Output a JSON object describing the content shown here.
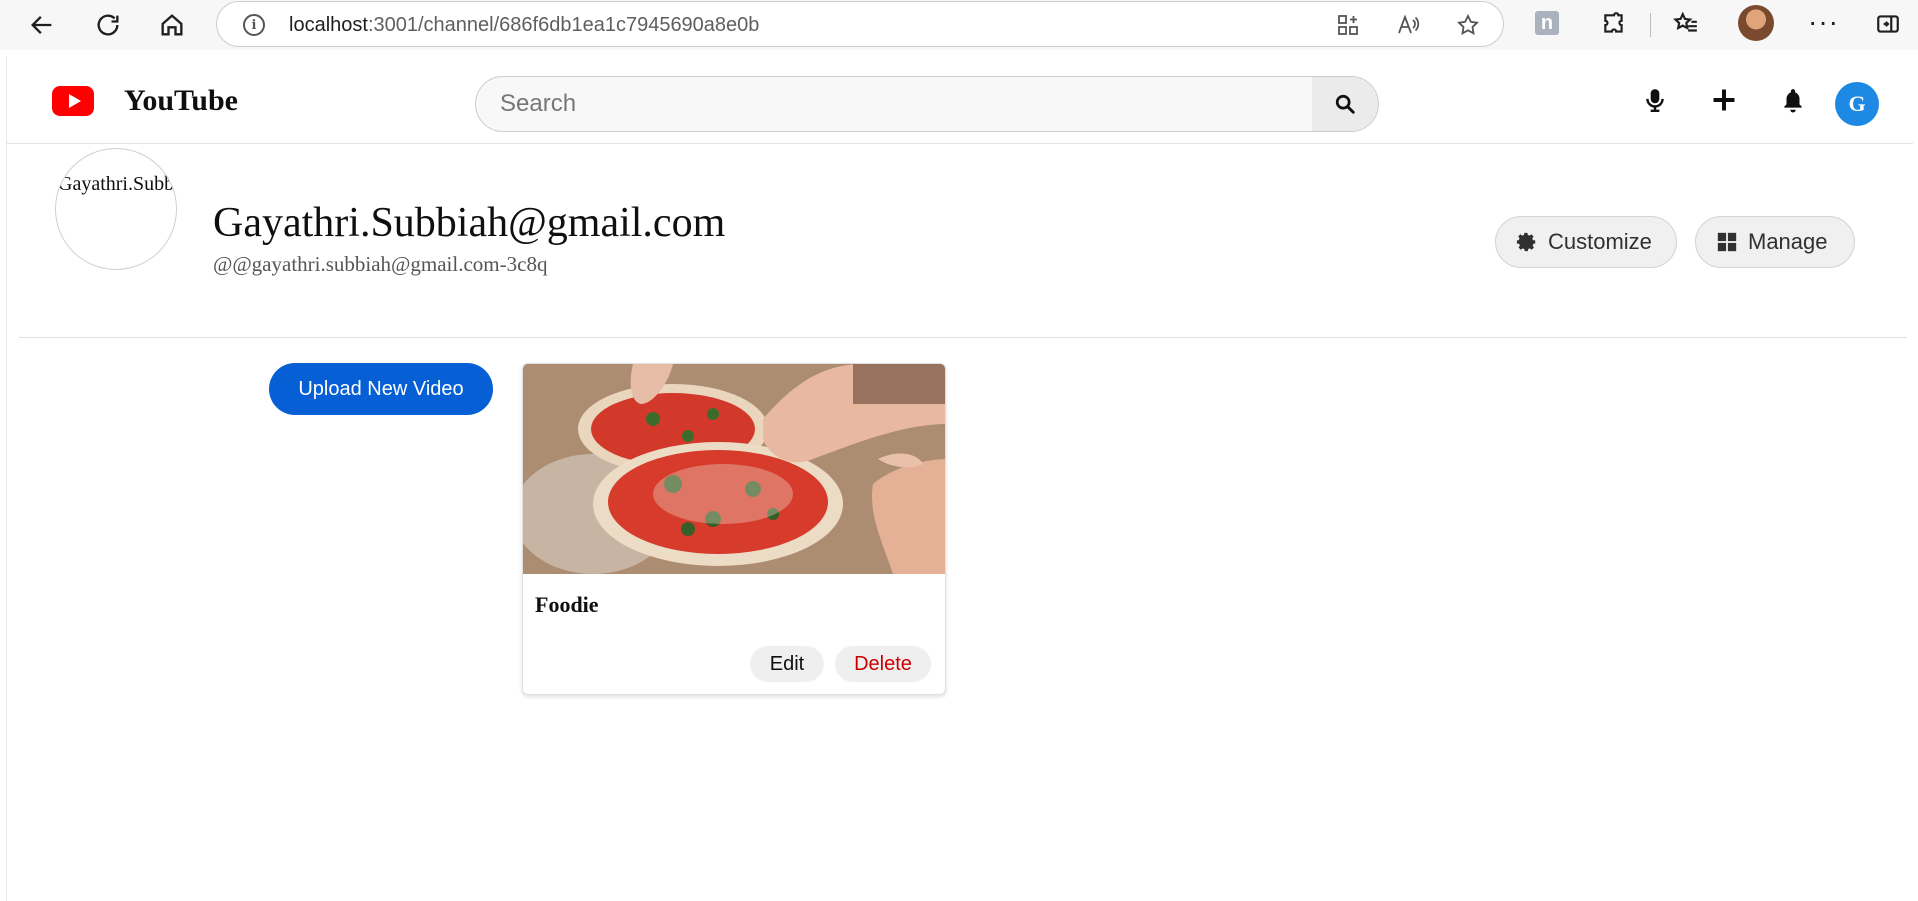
{
  "browser": {
    "url_host": "localhost",
    "url_path": ":3001/channel/686f6db1ea1c7945690a8e0b",
    "info_glyph": "i",
    "extension_letter": "n",
    "menu_glyph": "···"
  },
  "header": {
    "logo_text": "YouTube",
    "search_placeholder": "Search",
    "user_initial": "G",
    "logo_color": "#ff0000",
    "avatar_color": "#1e88e5"
  },
  "channel": {
    "avatar_alt": "Gayathri.Subbiah@gmail.com avatar",
    "name": "Gayathri.Subbiah@gmail.com",
    "handle": "@@gayathri.subbiah@gmail.com-3c8q",
    "customize_label": "Customize",
    "manage_label": "Manage"
  },
  "content": {
    "upload_label": "Upload New Video",
    "upload_color": "#065fd4",
    "videos": [
      {
        "title": "Foodie",
        "edit_label": "Edit",
        "delete_label": "Delete",
        "delete_color": "#cc0000"
      }
    ]
  }
}
